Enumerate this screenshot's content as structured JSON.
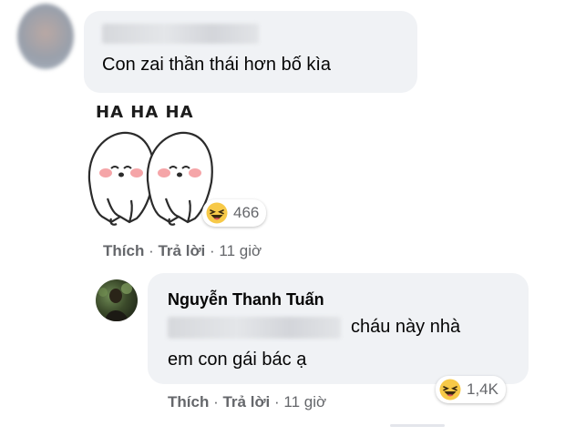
{
  "comment1": {
    "author_blurred": true,
    "text": "Con zai thần thái hơn bố kìa",
    "sticker": {
      "caption": "HA HA HA",
      "description_icon": "laughing-ghosts-sticker"
    },
    "reaction": {
      "icon": "haha-emoji-icon",
      "count": "466"
    },
    "actions": {
      "like": "Thích",
      "reply": "Trả lời",
      "time": "11 giờ",
      "sep": "·"
    }
  },
  "reply1": {
    "author": "Nguyễn Thanh Tuấn",
    "mention_blurred": true,
    "text_line1": "cháu này nhà",
    "text_line2": "em con gái bác ạ",
    "reaction": {
      "icon": "haha-emoji-icon",
      "count": "1,4K"
    },
    "actions": {
      "like": "Thích",
      "reply": "Trả lời",
      "time": "11 giờ",
      "sep": "·"
    }
  },
  "colors": {
    "bubble": "#f0f2f5",
    "text": "#050505",
    "secondary": "#65676b",
    "haha_yellow": "#f7c948"
  }
}
